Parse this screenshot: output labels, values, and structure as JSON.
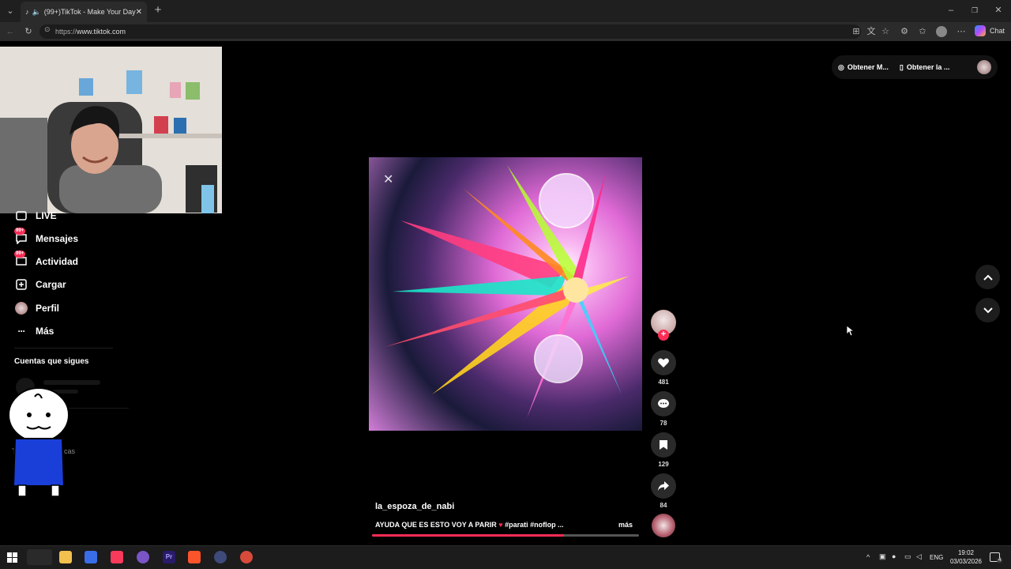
{
  "browser": {
    "tab_title": "(99+)TikTok - Make Your Day",
    "url_protocol": "https://",
    "url_host": "www.tiktok.com",
    "chat_label": "Chat"
  },
  "sidebar": {
    "items": [
      {
        "label": "LIVE",
        "icon": "live-icon"
      },
      {
        "label": "Mensajes",
        "icon": "messages-icon",
        "badge": "99+"
      },
      {
        "label": "Actividad",
        "icon": "activity-icon",
        "badge": "99+"
      },
      {
        "label": "Cargar",
        "icon": "upload-icon"
      },
      {
        "label": "Perfil",
        "icon": "profile-avatar"
      },
      {
        "label": "Más",
        "icon": "more-icon"
      }
    ],
    "following_title": "Cuentas que sigues",
    "terms": "Términos y políticas"
  },
  "header": {
    "get_coins": "Obtener M...",
    "get_app": "Obtener la ..."
  },
  "video": {
    "author": "la_espoza_de_nabi",
    "caption": "AYUDA QUE ES ESTO VOY A PARIR",
    "hashtags": "#parati #noflop ...",
    "more": "más",
    "progress": 0.72
  },
  "actions": {
    "likes": "481",
    "comments": "78",
    "saves": "129",
    "shares": "84"
  },
  "taskbar": {
    "language": "ENG",
    "time": "19:02",
    "date": "03/03/2026",
    "notifications": "4"
  },
  "colors": {
    "accent": "#fe2c55",
    "background": "#000000",
    "chrome": "#1f1f1f"
  }
}
